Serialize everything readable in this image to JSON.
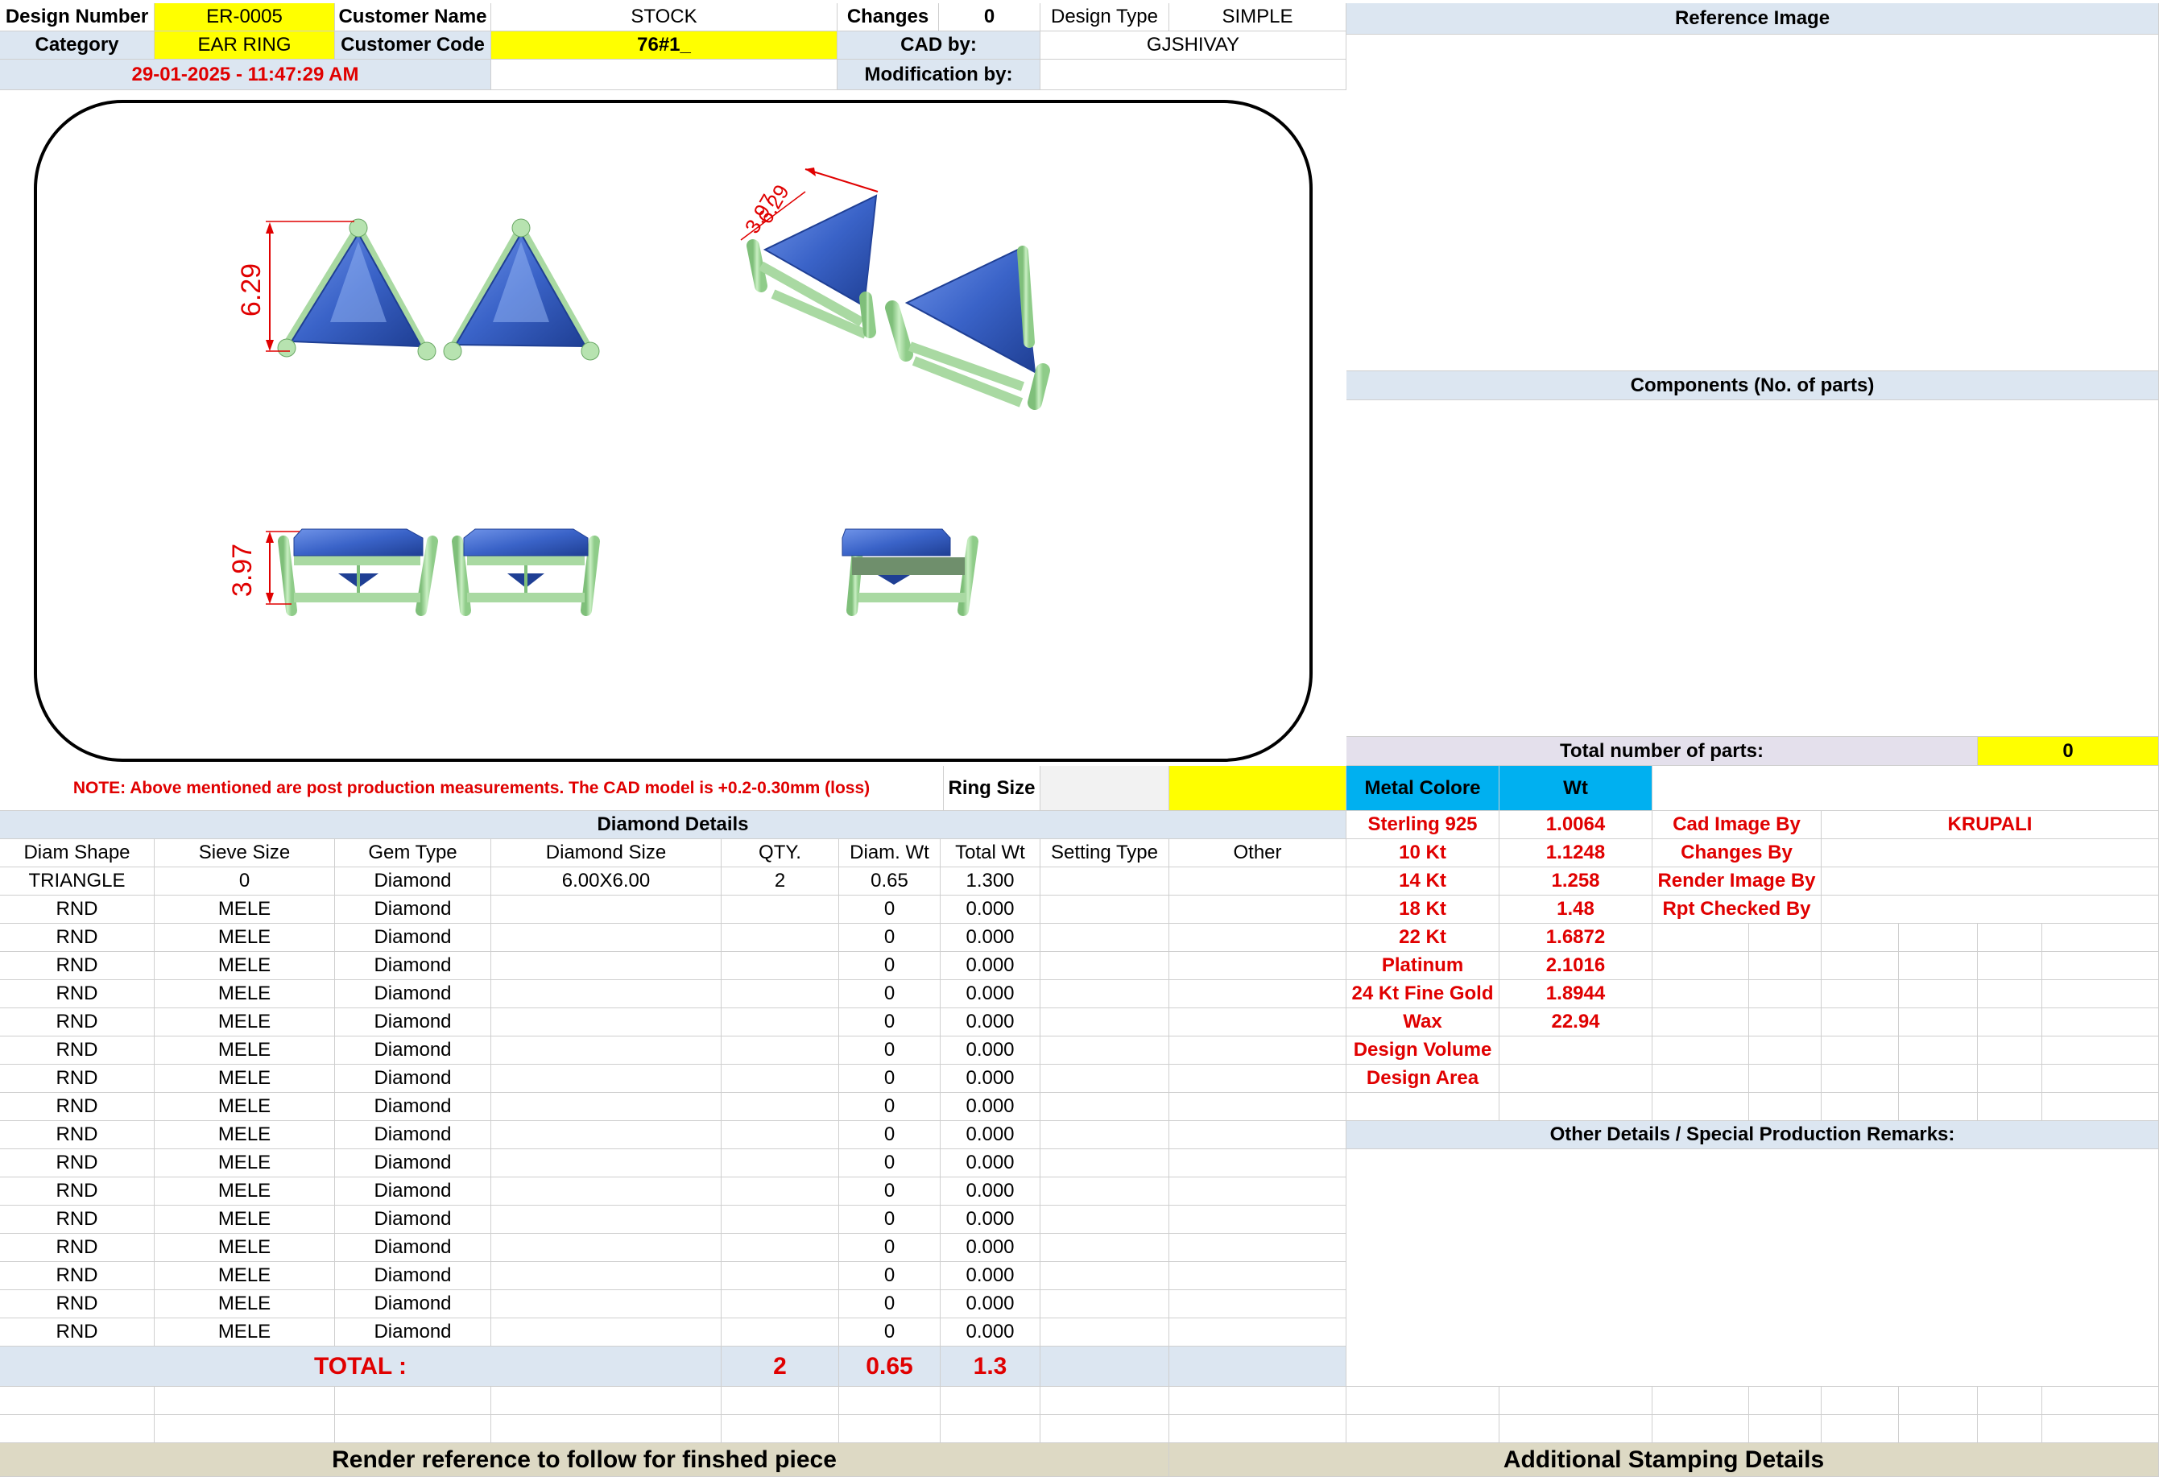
{
  "header": {
    "design_number_label": "Design Number",
    "design_number": "ER-0005",
    "customer_name_label": "Customer Name",
    "customer_name": "STOCK",
    "changes_label": "Changes",
    "changes": "0",
    "design_type_label": "Design Type",
    "design_type": "SIMPLE",
    "category_label": "Category",
    "category": "EAR RING",
    "customer_code_label": "Customer Code",
    "customer_code": "76#1_",
    "cad_by_label": "CAD by:",
    "cad_by": "GJSHIVAY",
    "timestamp": "29-01-2025 - 11:47:29 AM",
    "modification_by_label": "Modification by:",
    "modification_by": ""
  },
  "drawing": {
    "dim_height": "6.29",
    "dim_side": "3.97",
    "dim_top": "3.97",
    "dim_top2": "6.29"
  },
  "right_panel": {
    "reference_image_label": "Reference Image",
    "components_label": "Components (No. of parts)",
    "total_parts_label": "Total number of parts:",
    "total_parts": "0",
    "metal_colore_label": "Metal Colore",
    "wt_label": "Wt",
    "metals": [
      {
        "name": "Sterling 925",
        "wt": "1.0064"
      },
      {
        "name": "10 Kt",
        "wt": "1.1248"
      },
      {
        "name": "14 Kt",
        "wt": "1.258"
      },
      {
        "name": "18 Kt",
        "wt": "1.48"
      },
      {
        "name": "22 Kt",
        "wt": "1.6872"
      },
      {
        "name": "Platinum",
        "wt": "2.1016"
      },
      {
        "name": "24 Kt Fine Gold",
        "wt": "1.8944"
      },
      {
        "name": "Wax",
        "wt": "22.94"
      },
      {
        "name": "Design Volume",
        "wt": ""
      },
      {
        "name": "Design Area",
        "wt": ""
      }
    ],
    "credits": [
      {
        "label": "Cad Image By",
        "value": "KRUPALI"
      },
      {
        "label": "Changes By",
        "value": ""
      },
      {
        "label": "Render Image By",
        "value": ""
      },
      {
        "label": "Rpt Checked By",
        "value": ""
      }
    ],
    "other_details_label": "Other Details / Special Production Remarks:"
  },
  "note": "NOTE: Above mentioned are post production measurements. The CAD model is +0.2-0.30mm (loss)",
  "ring_size_label": "Ring Size",
  "ring_size": "",
  "diamond_details": {
    "title": "Diamond Details",
    "columns": [
      "Diam Shape",
      "Sieve Size",
      "Gem Type",
      "Diamond Size",
      "QTY.",
      "Diam. Wt",
      "Total Wt",
      "Setting Type",
      "Other"
    ],
    "rows": [
      [
        "TRIANGLE",
        "0",
        "Diamond",
        "6.00X6.00",
        "2",
        "0.65",
        "1.300",
        "",
        ""
      ],
      [
        "RND",
        "MELE",
        "Diamond",
        "",
        "",
        "0",
        "0.000",
        "",
        ""
      ],
      [
        "RND",
        "MELE",
        "Diamond",
        "",
        "",
        "0",
        "0.000",
        "",
        ""
      ],
      [
        "RND",
        "MELE",
        "Diamond",
        "",
        "",
        "0",
        "0.000",
        "",
        ""
      ],
      [
        "RND",
        "MELE",
        "Diamond",
        "",
        "",
        "0",
        "0.000",
        "",
        ""
      ],
      [
        "RND",
        "MELE",
        "Diamond",
        "",
        "",
        "0",
        "0.000",
        "",
        ""
      ],
      [
        "RND",
        "MELE",
        "Diamond",
        "",
        "",
        "0",
        "0.000",
        "",
        ""
      ],
      [
        "RND",
        "MELE",
        "Diamond",
        "",
        "",
        "0",
        "0.000",
        "",
        ""
      ],
      [
        "RND",
        "MELE",
        "Diamond",
        "",
        "",
        "0",
        "0.000",
        "",
        ""
      ],
      [
        "RND",
        "MELE",
        "Diamond",
        "",
        "",
        "0",
        "0.000",
        "",
        ""
      ],
      [
        "RND",
        "MELE",
        "Diamond",
        "",
        "",
        "0",
        "0.000",
        "",
        ""
      ],
      [
        "RND",
        "MELE",
        "Diamond",
        "",
        "",
        "0",
        "0.000",
        "",
        ""
      ],
      [
        "RND",
        "MELE",
        "Diamond",
        "",
        "",
        "0",
        "0.000",
        "",
        ""
      ],
      [
        "RND",
        "MELE",
        "Diamond",
        "",
        "",
        "0",
        "0.000",
        "",
        ""
      ],
      [
        "RND",
        "MELE",
        "Diamond",
        "",
        "",
        "0",
        "0.000",
        "",
        ""
      ],
      [
        "RND",
        "MELE",
        "Diamond",
        "",
        "",
        "0",
        "0.000",
        "",
        ""
      ],
      [
        "RND",
        "MELE",
        "Diamond",
        "",
        "",
        "0",
        "0.000",
        "",
        ""
      ]
    ],
    "total_label": "TOTAL :",
    "total_qty": "2",
    "total_diam_wt": "0.65",
    "total_wt": "1.3"
  },
  "footer": {
    "render_reference": "Render reference to follow for finshed piece",
    "additional_stamping": "Additional Stamping Details"
  },
  "colors": {
    "highlight": "#ffff00",
    "header_blue": "#dce6f1",
    "metal_header": "#00b0f0",
    "footer_tan": "#ddd9c4",
    "stone_blue": "#3a63c8",
    "metal_green": "#a9d9a2",
    "dimension_red": "#e00000"
  }
}
